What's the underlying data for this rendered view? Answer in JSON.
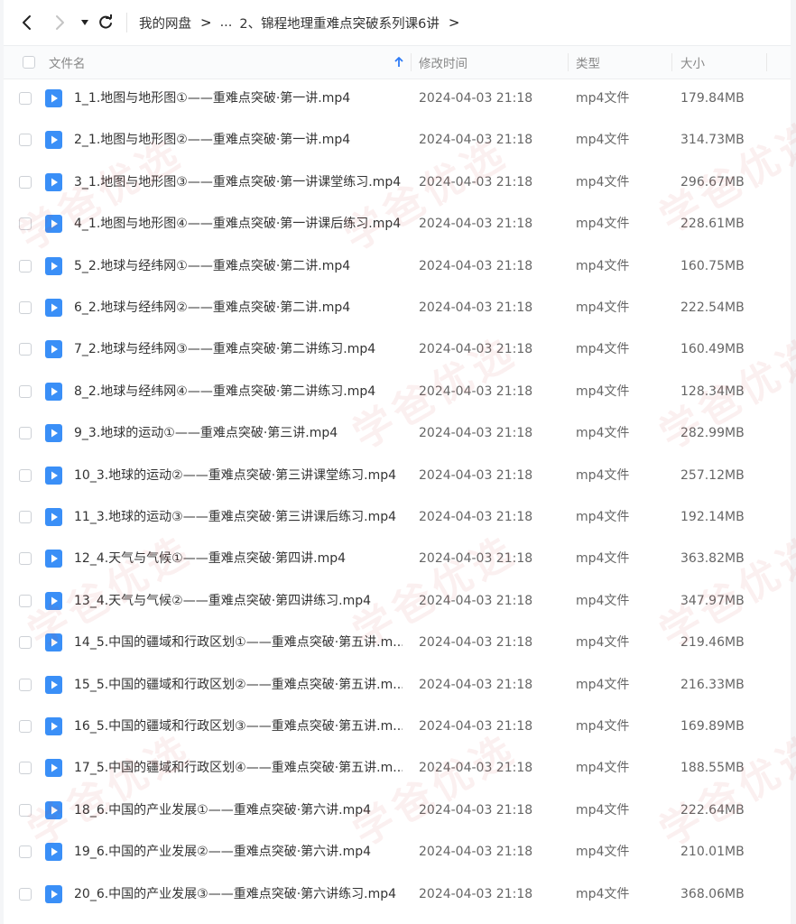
{
  "breadcrumb": {
    "root": "我的网盘",
    "ellipsis": "...",
    "current": "2、锦程地理重难点突破系列课6讲"
  },
  "columns": {
    "name": "文件名",
    "modified": "修改时间",
    "type": "类型",
    "size": "大小"
  },
  "watermark": "学爸优选",
  "files": [
    {
      "name": "1_1.地图与地形图①——重难点突破·第一讲.mp4",
      "modified": "2024-04-03 21:18",
      "type": "mp4文件",
      "size": "179.84MB"
    },
    {
      "name": "2_1.地图与地形图②——重难点突破·第一讲.mp4",
      "modified": "2024-04-03 21:18",
      "type": "mp4文件",
      "size": "314.73MB"
    },
    {
      "name": "3_1.地图与地形图③——重难点突破·第一讲课堂练习.mp4",
      "modified": "2024-04-03 21:18",
      "type": "mp4文件",
      "size": "296.67MB"
    },
    {
      "name": "4_1.地图与地形图④——重难点突破·第一讲课后练习.mp4",
      "modified": "2024-04-03 21:18",
      "type": "mp4文件",
      "size": "228.61MB"
    },
    {
      "name": "5_2.地球与经纬网①——重难点突破·第二讲.mp4",
      "modified": "2024-04-03 21:18",
      "type": "mp4文件",
      "size": "160.75MB"
    },
    {
      "name": "6_2.地球与经纬网②——重难点突破·第二讲.mp4",
      "modified": "2024-04-03 21:18",
      "type": "mp4文件",
      "size": "222.54MB"
    },
    {
      "name": "7_2.地球与经纬网③——重难点突破·第二讲练习.mp4",
      "modified": "2024-04-03 21:18",
      "type": "mp4文件",
      "size": "160.49MB"
    },
    {
      "name": "8_2.地球与经纬网④——重难点突破·第二讲练习.mp4",
      "modified": "2024-04-03 21:18",
      "type": "mp4文件",
      "size": "128.34MB"
    },
    {
      "name": "9_3.地球的运动①——重难点突破·第三讲.mp4",
      "modified": "2024-04-03 21:18",
      "type": "mp4文件",
      "size": "282.99MB"
    },
    {
      "name": "10_3.地球的运动②——重难点突破·第三讲课堂练习.mp4",
      "modified": "2024-04-03 21:18",
      "type": "mp4文件",
      "size": "257.12MB"
    },
    {
      "name": "11_3.地球的运动③——重难点突破·第三讲课后练习.mp4",
      "modified": "2024-04-03 21:18",
      "type": "mp4文件",
      "size": "192.14MB"
    },
    {
      "name": "12_4.天气与气候①——重难点突破·第四讲.mp4",
      "modified": "2024-04-03 21:18",
      "type": "mp4文件",
      "size": "363.82MB"
    },
    {
      "name": "13_4.天气与气候②——重难点突破·第四讲练习.mp4",
      "modified": "2024-04-03 21:18",
      "type": "mp4文件",
      "size": "347.97MB"
    },
    {
      "name": "14_5.中国的疆域和行政区划①——重难点突破·第五讲.m...",
      "modified": "2024-04-03 21:18",
      "type": "mp4文件",
      "size": "219.46MB"
    },
    {
      "name": "15_5.中国的疆域和行政区划②——重难点突破·第五讲.m...",
      "modified": "2024-04-03 21:18",
      "type": "mp4文件",
      "size": "216.33MB"
    },
    {
      "name": "16_5.中国的疆域和行政区划③——重难点突破·第五讲.m...",
      "modified": "2024-04-03 21:18",
      "type": "mp4文件",
      "size": "169.89MB"
    },
    {
      "name": "17_5.中国的疆域和行政区划④——重难点突破·第五讲.m...",
      "modified": "2024-04-03 21:18",
      "type": "mp4文件",
      "size": "188.55MB"
    },
    {
      "name": "18_6.中国的产业发展①——重难点突破·第六讲.mp4",
      "modified": "2024-04-03 21:18",
      "type": "mp4文件",
      "size": "222.64MB"
    },
    {
      "name": "19_6.中国的产业发展②——重难点突破·第六讲.mp4",
      "modified": "2024-04-03 21:18",
      "type": "mp4文件",
      "size": "210.01MB"
    },
    {
      "name": "20_6.中国的产业发展③——重难点突破·第六讲练习.mp4",
      "modified": "2024-04-03 21:18",
      "type": "mp4文件",
      "size": "368.06MB"
    }
  ]
}
